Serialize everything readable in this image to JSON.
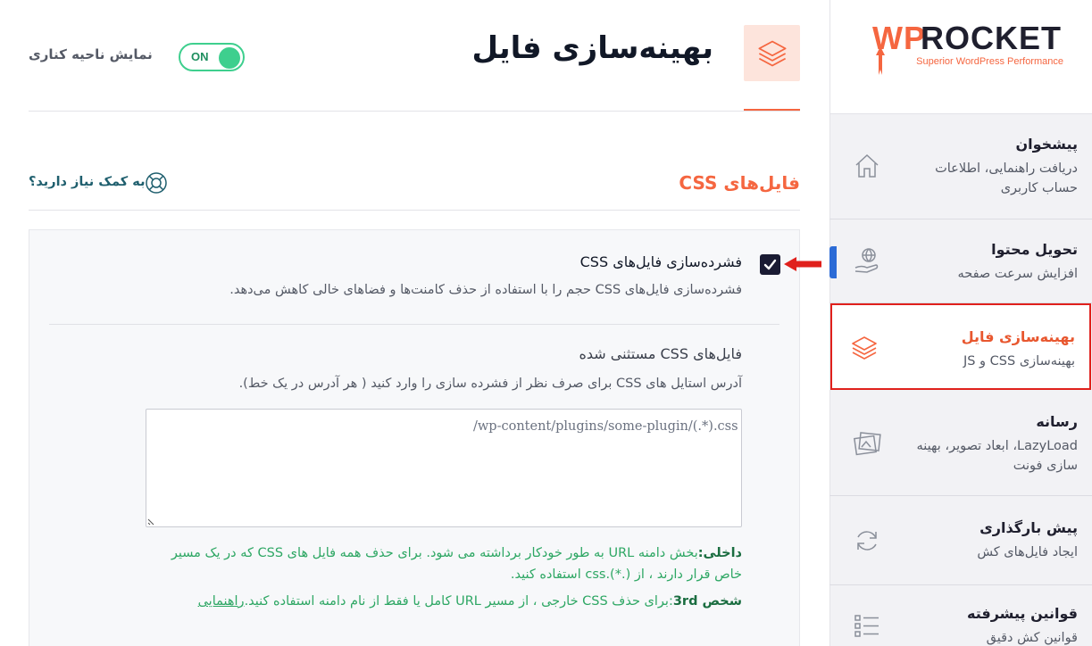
{
  "brand": {
    "wp": "WP",
    "rocket": "ROCKET",
    "tagline": "Superior WordPress Performance",
    "accent_color": "#f56640"
  },
  "sidebar": {
    "items": [
      {
        "title": "پیشخوان",
        "desc": "دریافت راهنمایی، اطلاعات حساب کاربری",
        "icon": "home-icon"
      },
      {
        "title": "تحویل محتوا",
        "desc": "افزایش سرعت صفحه",
        "icon": "cdn-hand-icon"
      },
      {
        "title": "بهینه‌سازی فایل",
        "desc": "بهینه‌سازی CSS و JS",
        "icon": "layers-icon",
        "active": true
      },
      {
        "title": "رسانه",
        "desc": "LazyLoad، ابعاد تصویر، بهینه سازی فونت",
        "icon": "images-icon"
      },
      {
        "title": "پیش بارگذاری",
        "desc": "ایجاد فایل‌های کش",
        "icon": "refresh-icon"
      },
      {
        "title": "قوانین پیشرفته",
        "desc": "قوانین کش دقیق",
        "icon": "list-icon"
      }
    ]
  },
  "header": {
    "title": "بهینه‌سازی فایل",
    "icon": "layers-icon",
    "sidebar_toggle_label": "نمایش ناحیه کناری",
    "toggle_state": "ON"
  },
  "section": {
    "title": "فایل‌های CSS",
    "help_label": "به کمک نیاز دارید؟",
    "help_icon": "lifebuoy-icon"
  },
  "option": {
    "title": "فشرده‌سازی فایل‌های CSS",
    "desc": "فشرده‌سازی فایل‌های CSS حجم را با استفاده از حذف کامنت‌ها و فضاهای خالی کاهش می‌دهد.",
    "checked": true
  },
  "excluded": {
    "title": "فایل‌های CSS مستثنی شده",
    "desc": "آدرس استایل های CSS برای صرف نظر از فشرده سازی را وارد کنید ( هر آدرس در یک خط).",
    "placeholder": "/wp-content/plugins/some-plugin/(.*).css",
    "value": ""
  },
  "notes": {
    "internal_label": "داخلی:",
    "internal_text": "بخش دامنه URL به طور خودکار برداشته می شود. برای حذف همه فایل های CSS که در یک مسیر خاص قرار دارند ، از (.*).css استفاده کنید.",
    "third_label": "شخص 3rd",
    "third_text": ":برای حذف CSS خارجی ، از مسیر URL کامل یا فقط از نام دامنه استفاده کنید.",
    "guide_link": "راهنمایی"
  }
}
